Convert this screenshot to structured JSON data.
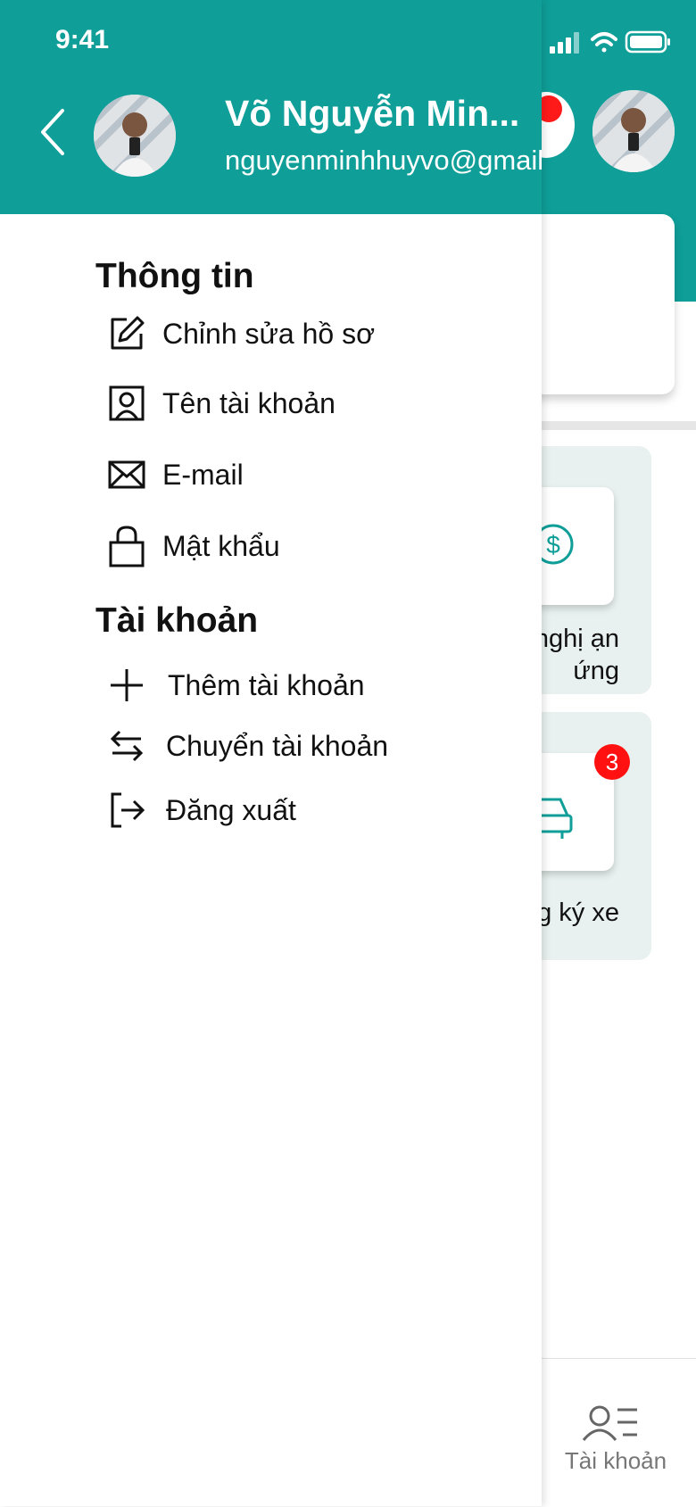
{
  "status_bar": {
    "time": "9:41"
  },
  "drawer": {
    "user": {
      "name": "Võ Nguyễn Min...",
      "email": "nguyenminhhuyvo@gmail"
    },
    "sections": [
      {
        "title": "Thông tin",
        "items": [
          {
            "label": "Chỉnh sửa hồ sơ",
            "icon": "edit-icon"
          },
          {
            "label": "Tên tài khoản",
            "icon": "user-square-icon"
          },
          {
            "label": "E-mail",
            "icon": "mail-icon"
          },
          {
            "label": "Mật khẩu",
            "icon": "lock-icon"
          }
        ]
      },
      {
        "title": "Tài khoản",
        "items": [
          {
            "label": "Thêm tài khoản",
            "icon": "plus-icon"
          },
          {
            "label": "Chuyển tài khoản",
            "icon": "switch-icon"
          },
          {
            "label": "Đăng xuất",
            "icon": "logout-icon"
          }
        ]
      }
    ]
  },
  "background": {
    "tiles": [
      {
        "label": "ề nghị ạn ứng",
        "icon": "dollar-icon"
      },
      {
        "label": "g ký xe",
        "icon": "car-icon",
        "badge": "3"
      }
    ],
    "tabbar": {
      "account_label": "Tài khoản"
    }
  },
  "colors": {
    "primary": "#0f9e98",
    "badge": "#ff1111",
    "tile_bg": "#e8f1ef"
  }
}
